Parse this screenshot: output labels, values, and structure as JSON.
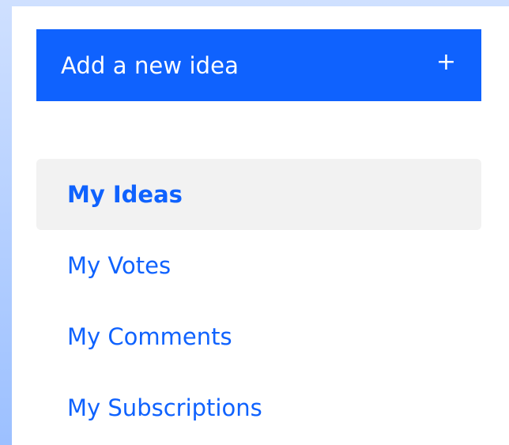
{
  "add_button": {
    "label": "Add a new idea",
    "icon": "plus-icon",
    "icon_glyph": "+"
  },
  "nav": {
    "items": [
      {
        "label": "My Ideas",
        "active": true
      },
      {
        "label": "My Votes",
        "active": false
      },
      {
        "label": "My Comments",
        "active": false
      },
      {
        "label": "My Subscriptions",
        "active": false
      }
    ]
  },
  "colors": {
    "accent": "#0f62fe",
    "active_bg": "#f2f2f2",
    "panel_bg": "#ffffff"
  }
}
